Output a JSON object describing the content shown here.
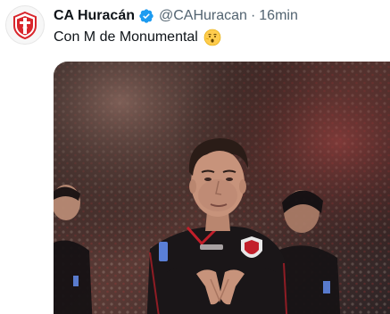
{
  "tweet": {
    "display_name": "CA Huracán",
    "handle": "@CAHuracan",
    "separator": "·",
    "timestamp": "16min",
    "text": "Con M de Monumental",
    "verified": true
  },
  "icons": {
    "avatar": "club-crest-icon",
    "verified": "verified-badge-icon",
    "emoji": "hushed-face-emoji"
  },
  "media": {
    "kind": "photo",
    "description": "player-celebration"
  },
  "colors": {
    "name": "#0f1419",
    "meta": "#536471",
    "verified_badge": "#1d9bf0",
    "crest_red": "#d9262c"
  }
}
